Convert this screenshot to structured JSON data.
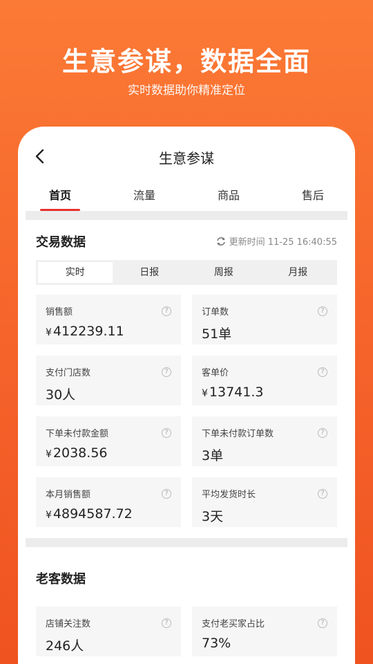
{
  "hero": {
    "title": "生意参谋，数据全面",
    "subtitle": "实时数据助你精准定位"
  },
  "nav": {
    "title": "生意参谋",
    "back_icon": "chevron-left-icon"
  },
  "tabs": [
    {
      "label": "首页",
      "active": true
    },
    {
      "label": "流量",
      "active": false
    },
    {
      "label": "商品",
      "active": false
    },
    {
      "label": "售后",
      "active": false
    }
  ],
  "trade": {
    "title": "交易数据",
    "update_time": "更新时间 11-25 16:40:55",
    "periods": [
      {
        "label": "实时",
        "active": true
      },
      {
        "label": "日报",
        "active": false
      },
      {
        "label": "周报",
        "active": false
      },
      {
        "label": "月报",
        "active": false
      }
    ],
    "metrics": [
      {
        "label": "销售额",
        "prefix": "¥",
        "value": "412239.11"
      },
      {
        "label": "订单数",
        "prefix": "",
        "value": "51单"
      },
      {
        "label": "支付门店数",
        "prefix": "",
        "value": "30人"
      },
      {
        "label": "客单价",
        "prefix": "¥",
        "value": "13741.3"
      },
      {
        "label": "下单未付款金额",
        "prefix": "¥",
        "value": "2038.56"
      },
      {
        "label": "下单未付款订单数",
        "prefix": "",
        "value": "3单"
      },
      {
        "label": "本月销售额",
        "prefix": "¥",
        "value": "4894587.72"
      },
      {
        "label": "平均发货时长",
        "prefix": "",
        "value": "3天"
      }
    ]
  },
  "customers": {
    "title": "老客数据",
    "metrics": [
      {
        "label": "店铺关注数",
        "prefix": "",
        "value": "246人"
      },
      {
        "label": "支付老买家占比",
        "prefix": "",
        "value": "73%"
      }
    ]
  },
  "colors": {
    "brand_orange": "#f5622a",
    "active_tab_underline": "#e8302e"
  }
}
